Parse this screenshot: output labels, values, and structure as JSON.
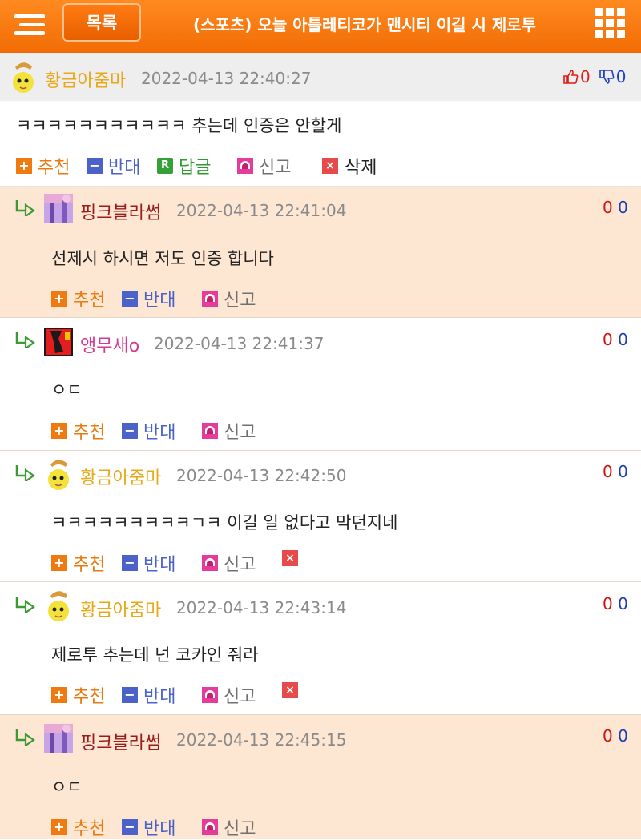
{
  "header": {
    "menu_icon": "hamburger-menu-icon",
    "list_label": "목록",
    "title": "(스포츠) 오늘 아틀레티코가 맨시티 이길 시 제로투",
    "grid_icon": "grid-menu-icon"
  },
  "main_comment": {
    "nickname": "황금아줌마",
    "datetime": "2022-04-13 22:40:27",
    "likes": "0",
    "dislikes": "0",
    "text": "ㅋㅋㅋㅋㅋㅋㅋㅋㅋㅋㅋ 추는데 인증은 안할게",
    "actions": {
      "recommend": "추천",
      "oppose": "반대",
      "reply": "답글",
      "report": "신고",
      "delete": "삭제"
    }
  },
  "replies": [
    {
      "nickname": "핑크블라썸",
      "datetime": "2022-04-13 22:41:04",
      "up": "0",
      "down": "0",
      "text": "선제시 하시면 저도 인증 합니다",
      "recommend": "추천",
      "oppose": "반대",
      "report": "신고"
    },
    {
      "nickname": "앵무새o",
      "datetime": "2022-04-13 22:41:37",
      "up": "0",
      "down": "0",
      "text": "ㅇㄷ",
      "recommend": "추천",
      "oppose": "반대",
      "report": "신고"
    },
    {
      "nickname": "황금아줌마",
      "datetime": "2022-04-13 22:42:50",
      "up": "0",
      "down": "0",
      "text": "ㅋㅋㅋㅋㅋㅋㅋㅋㅋㄱㅋ 이길 일 없다고 막던지네",
      "recommend": "추천",
      "oppose": "반대",
      "report": "신고"
    },
    {
      "nickname": "황금아줌마",
      "datetime": "2022-04-13 22:43:14",
      "up": "0",
      "down": "0",
      "text": "제로투 추는데 넌 코카인 줘라",
      "recommend": "추천",
      "oppose": "반대",
      "report": "신고"
    },
    {
      "nickname": "핑크블라썸",
      "datetime": "2022-04-13 22:45:15",
      "up": "0",
      "down": "0",
      "text": "ㅇㄷ",
      "recommend": "추천",
      "oppose": "반대",
      "report": "신고"
    }
  ],
  "colors": {
    "header_orange": "#f47a10",
    "nick_gold": "#e8a817",
    "nick_maroon": "#9c1c1c",
    "nick_pink": "#d63a8f",
    "highlight_row": "#fde6d2"
  }
}
